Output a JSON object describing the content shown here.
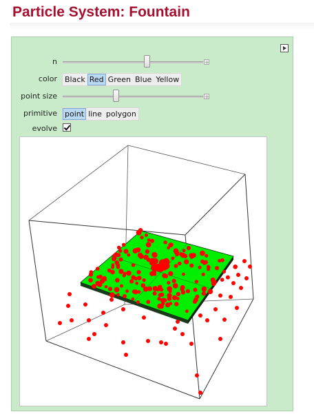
{
  "title": "Particle System: Fountain",
  "controls": {
    "n_label": "n",
    "n_value": 0.45,
    "color_label": "color",
    "color_options": [
      "Black",
      "Red",
      "Green",
      "Blue",
      "Yellow"
    ],
    "color_selected": "Red",
    "point_size_label": "point size",
    "point_size_value": 0.37,
    "primitive_label": "primitive",
    "primitive_options": [
      "point",
      "line",
      "polygon"
    ],
    "primitive_selected": "point",
    "evolve_label": "evolve",
    "evolve_checked": true
  },
  "colors": {
    "title": "#a5102f",
    "panel_bg": "#c9ebc9",
    "particle": "#ff0000",
    "platform": "#00ee00",
    "selected": "#b9d9f3"
  },
  "icons": [
    "play-arrow-icon",
    "plus-icon",
    "checkmark-icon"
  ]
}
